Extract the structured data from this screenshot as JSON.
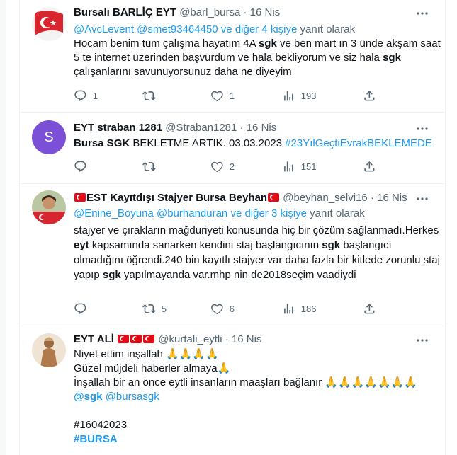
{
  "tweets": [
    {
      "name": "Bursalı BARLİÇ EYT",
      "handle": "@barl_bursa",
      "time": "16 Nis",
      "reply_prefix": "",
      "reply_to": "@AvcLevent @smet93464450 ve diğer 4 kişiye",
      "reply_suffix": "yanıt olarak",
      "text_parts": [
        "Hocam benim tüm çalışma hayatım 4A ",
        "sgk",
        " ve ben mart ın 3 ünde akşam saat 5 te internet üzerinden başvurdum ve hala bekliyorum ve siz hala ",
        "sgk",
        " çalışanlarını savunuyorsunuz daha ne diyeyim"
      ],
      "replies": "1",
      "retweets": "",
      "likes": "1",
      "views": "193"
    },
    {
      "name": "EYT straban 1281",
      "handle": "@Straban1281",
      "time": "16 Nis",
      "avatar_letter": "S",
      "text_main": "Bursa SGK",
      "text_rest": " BEKLETME ARTIK. 03.03.2023 ",
      "hashtag": "#23YılGeçtiEvrakBEKLEMEDE",
      "replies": "",
      "retweets": "",
      "likes": "2",
      "views": "151"
    },
    {
      "name": "EST Kayıtdışı Stajyer Bursa Beyhan",
      "handle": "@beyhan_selvi16",
      "time": "16 Nis",
      "reply_to": "@Enine_Boyuna @burhanduran ve diğer 3 kişiye",
      "reply_suffix": "yanıt olarak",
      "text_parts": [
        "stajyer ve çırakların mağduriyeti konusunda hiç bir çözüm sağlanmadı.Herkes ",
        "eyt",
        " kapsamında sanarken kendini staj başlangıcının ",
        "sgk",
        " başlangıcı olmadığını öğrendi.240 bin kayıtlı stajyer var daha fazla bir kitlede zorunlu staj yapıp ",
        "sgk",
        " yapılmayanda var.mhp nin de2018seçim vaadiydi"
      ],
      "replies": "",
      "retweets": "5",
      "likes": "6",
      "views": "186"
    },
    {
      "name": "EYT ALİ",
      "handle": "@kurtali_eytli",
      "time": "16 Nis",
      "line1": "Niyet ettim inşallah",
      "line2": "Güzel müjdeli haberler almaya",
      "line3": "İnşallah bir an önce eytli insanların maaşları bağlanır",
      "mention1": "@sgk",
      "mention2": "@bursasgk",
      "tag1": "#16042023",
      "tag2": "#BURSA"
    }
  ],
  "dot": "·",
  "icons": {
    "more": "more-icon",
    "reply": "reply-icon",
    "retweet": "retweet-icon",
    "like": "heart-icon",
    "views": "views-icon",
    "share": "share-icon"
  }
}
